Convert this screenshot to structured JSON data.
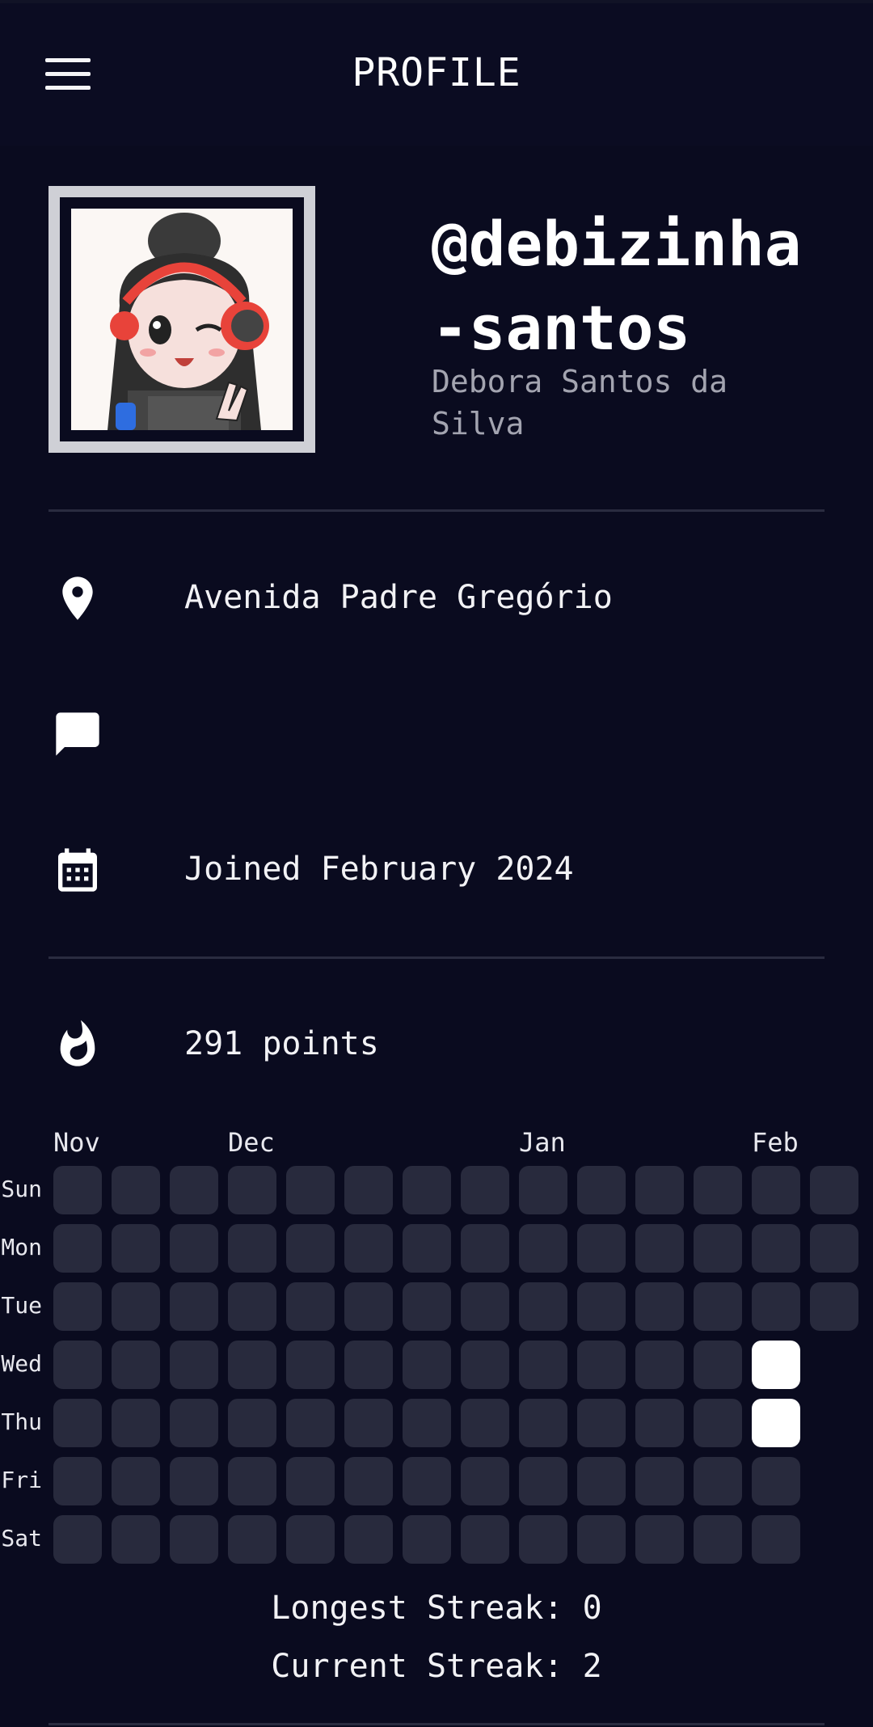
{
  "header": {
    "title": "PROFILE"
  },
  "profile": {
    "username": "@debizinha-santos",
    "full_name": "Debora Santos da Silva"
  },
  "details": {
    "location": "Avenida Padre Gregório",
    "status": "",
    "joined": "Joined February 2024"
  },
  "points": {
    "label": "291 points"
  },
  "activity": {
    "months": [
      {
        "label": "Nov",
        "col": 0
      },
      {
        "label": "Dec",
        "col": 3
      },
      {
        "label": "Jan",
        "col": 8
      },
      {
        "label": "Feb",
        "col": 12
      }
    ],
    "days": [
      "Sun",
      "Mon",
      "Tue",
      "Wed",
      "Thu",
      "Fri",
      "Sat"
    ],
    "column_lengths": [
      7,
      7,
      7,
      7,
      7,
      7,
      7,
      7,
      7,
      7,
      7,
      7,
      7,
      3
    ],
    "active": [
      [
        12,
        3
      ],
      [
        12,
        4
      ]
    ]
  },
  "streaks": {
    "longest": "Longest Streak: 0",
    "current": "Current Streak: 2"
  },
  "colors": {
    "background": "#0a0b1f",
    "cell_empty": "#282a3d",
    "cell_active": "#ffffff"
  },
  "icons": {
    "menu": "menu-icon",
    "location": "location-pin-icon",
    "status": "chat-bubble-icon",
    "joined": "calendar-icon",
    "points": "flame-icon"
  }
}
